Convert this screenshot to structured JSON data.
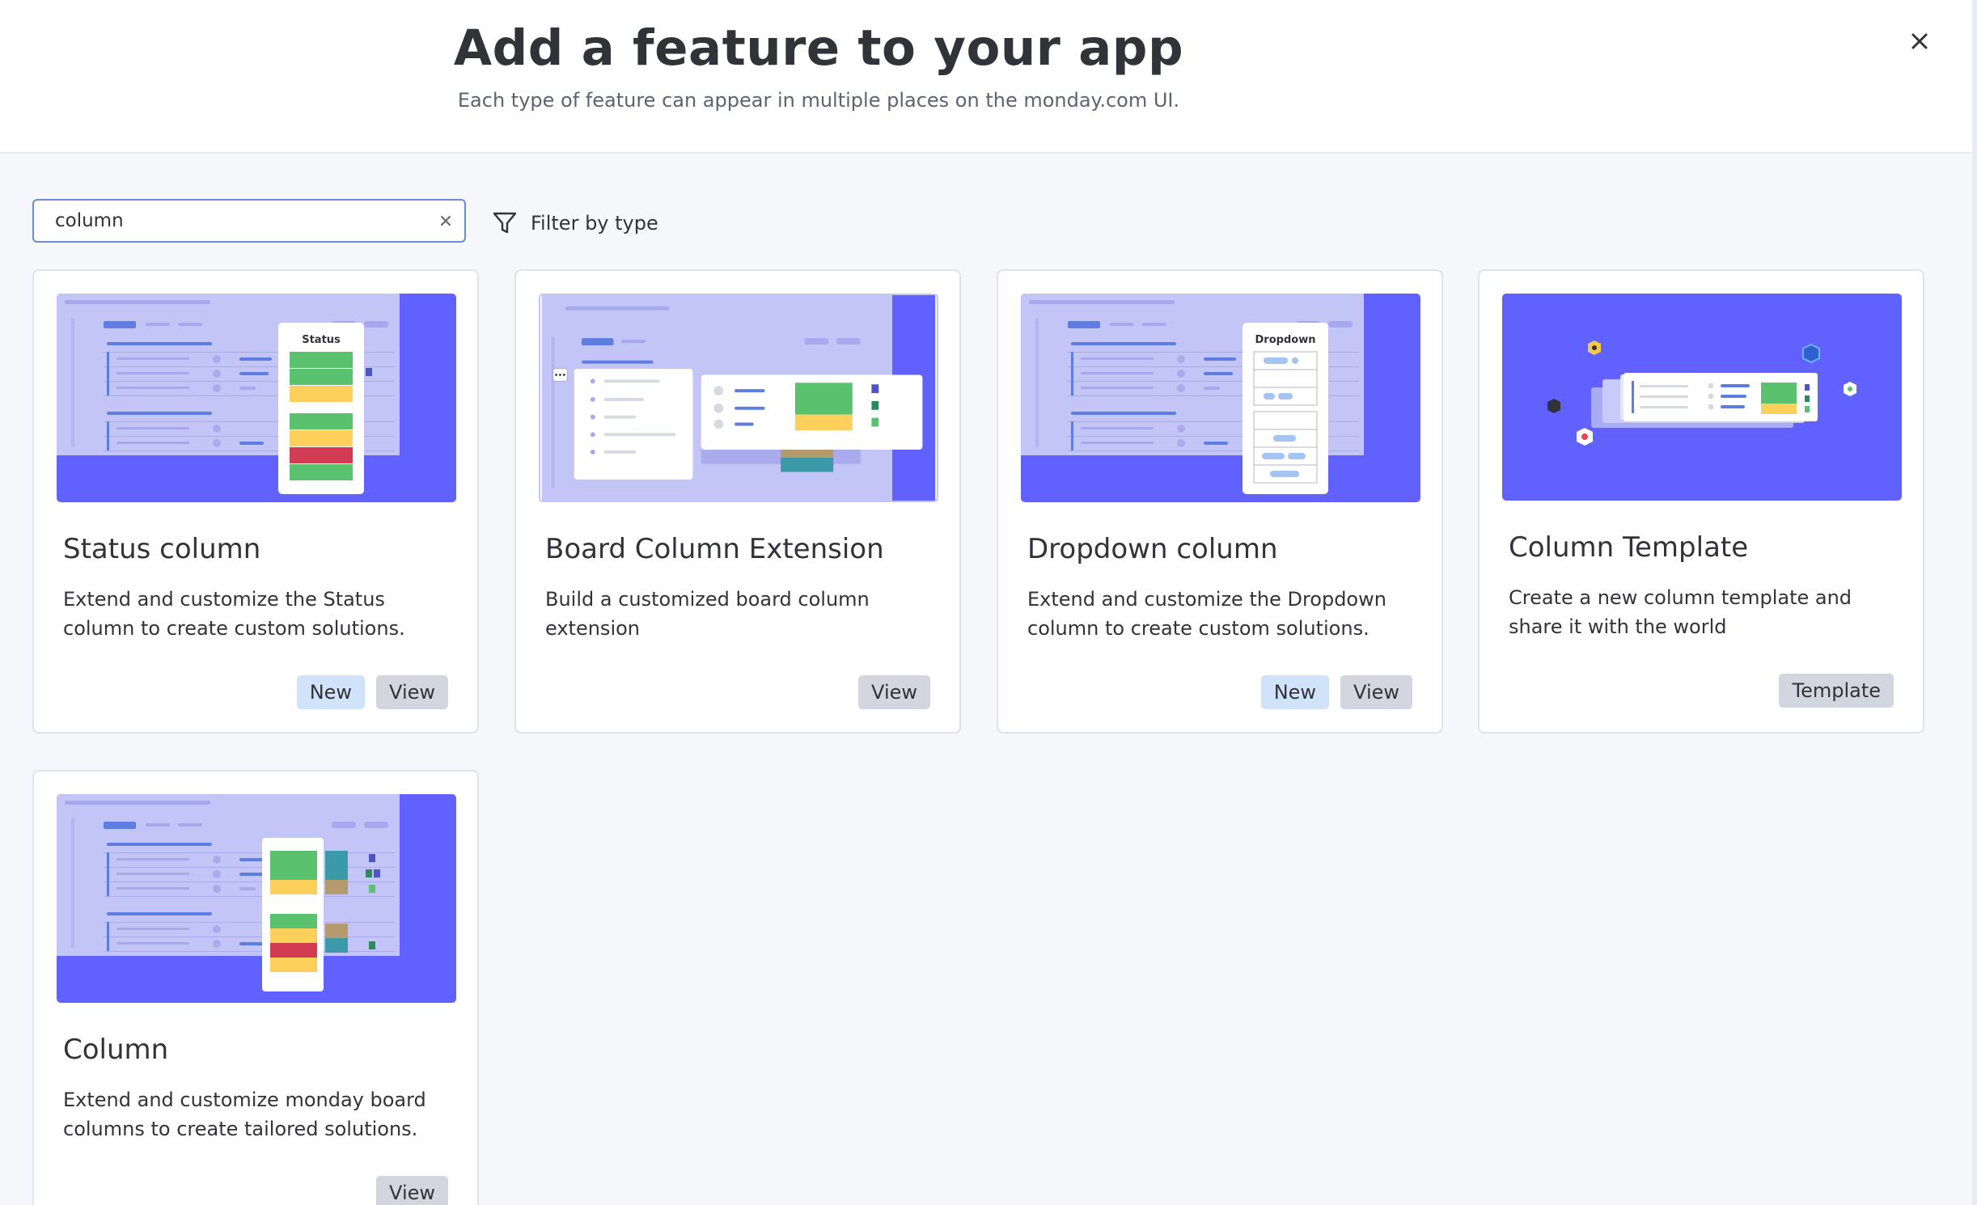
{
  "dialog": {
    "title": "Add a feature to your app",
    "subtitle": "Each type of feature can appear in multiple places on the monday.com UI.",
    "close_icon": "close-icon"
  },
  "search": {
    "value": "column",
    "clear_icon": "clear-icon"
  },
  "filter": {
    "label": "Filter by type",
    "icon": "filter-icon"
  },
  "colors": {
    "accent": "#6161ff",
    "status_green": "#5ac26f",
    "status_yellow": "#fcd05a",
    "status_red": "#d33b53"
  },
  "cards": [
    {
      "title": "Status column",
      "description": "Extend and customize the Status column to create custom solutions.",
      "preview_label": "Status",
      "badges": [
        "New",
        "View"
      ]
    },
    {
      "title": "Board Column Extension",
      "description": "Build a customized board column extension",
      "badges": [
        "View"
      ]
    },
    {
      "title": "Dropdown column",
      "description": "Extend and customize the Dropdown column to create custom solutions.",
      "preview_label": "Dropdown",
      "badges": [
        "New",
        "View"
      ]
    },
    {
      "title": "Column Template",
      "description": "Create a new column template and share it with the world",
      "badges": [
        "Template"
      ]
    },
    {
      "title": "Column",
      "description": "Extend and customize monday board columns to create tailored solutions.",
      "badges": [
        "View"
      ]
    }
  ]
}
